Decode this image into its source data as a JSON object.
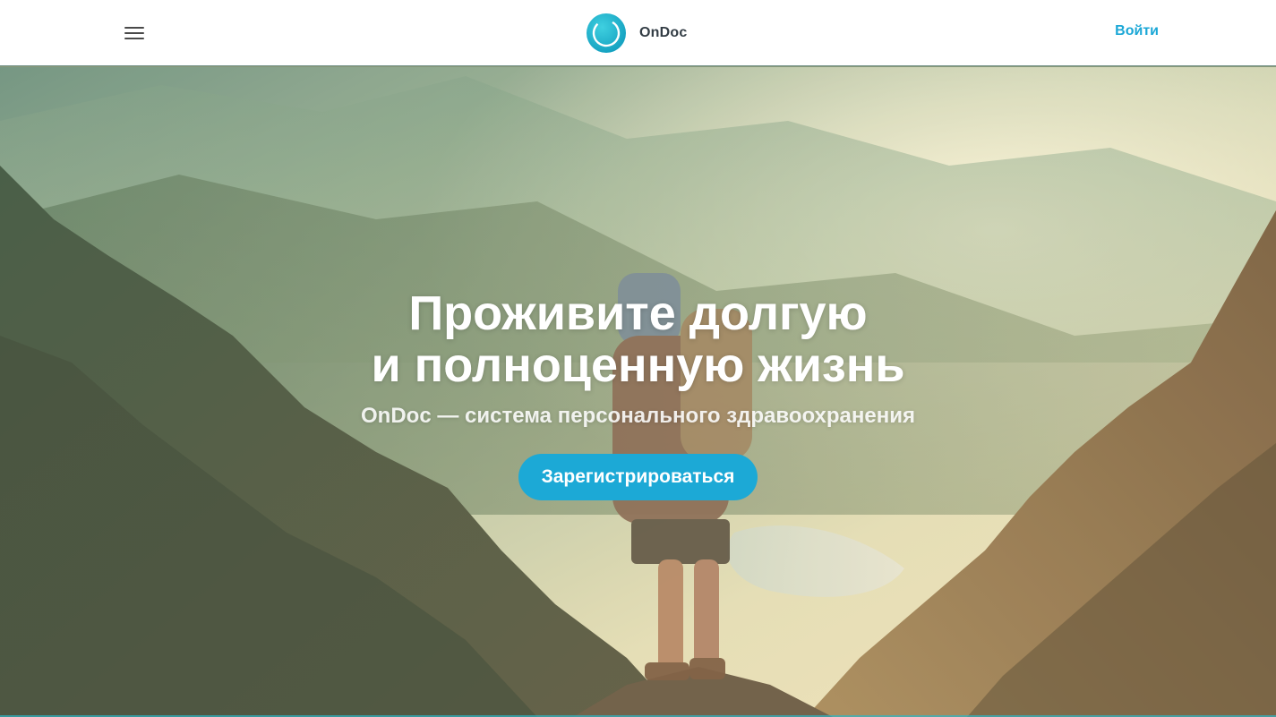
{
  "header": {
    "brand_name": "OnDoc",
    "login_label": "Войти"
  },
  "hero": {
    "title_line1": "Проживите долгую",
    "title_line2": "и полноценную жизнь",
    "subtitle": "OnDoc — система персонального здравоохранения",
    "signup_label": "Зарегистрироваться"
  },
  "icons": {
    "menu": "hamburger-menu-icon",
    "logo": "ondoc-logo-icon"
  },
  "colors": {
    "accent": "#1ca9d6",
    "link": "#1ba7d6",
    "brand_text": "#333d45"
  }
}
